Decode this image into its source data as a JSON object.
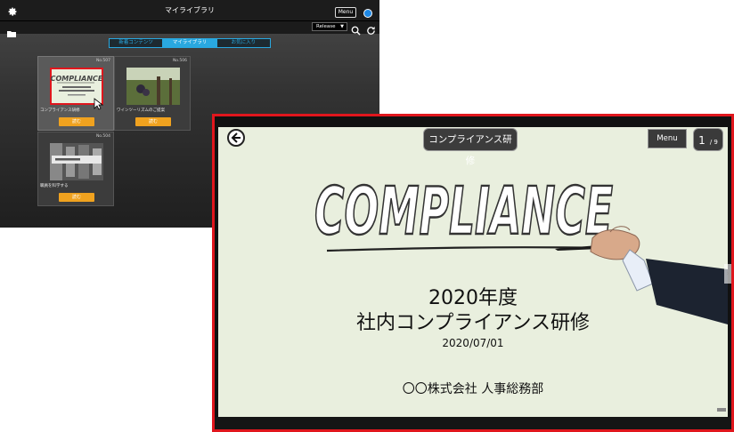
{
  "library": {
    "title": "マイライブラリ",
    "menu_label": "Menu",
    "release_select": "Release",
    "icons": {
      "settings": "gear-icon",
      "folder": "folder-icon",
      "search": "search-icon",
      "refresh": "refresh-icon",
      "user": "user-icon"
    },
    "tabs": [
      {
        "label": "新着コンテンツ",
        "active": false
      },
      {
        "label": "マイライブラリ",
        "active": true
      },
      {
        "label": "お気に入り",
        "active": false
      }
    ],
    "cards": [
      {
        "no": "No.507",
        "label": "コンプライアンス研修",
        "button": "読む"
      },
      {
        "no": "No.506",
        "label": "ワインツーリズムのご提案",
        "button": "読む"
      },
      {
        "no": "No.504",
        "label": "職員を科学する",
        "button": "読む"
      }
    ],
    "colors": {
      "accent": "#29a8e0",
      "button": "#f0a21f"
    }
  },
  "viewer": {
    "deck_title": "コンプライアンス研修",
    "menu_label": "Menu",
    "page": {
      "current": "1",
      "total": "/ 9"
    },
    "border_color": "#e0161d",
    "slide": {
      "headline": "COMPLIANCE",
      "year": "2020年度",
      "course": "社内コンプライアンス研修",
      "date": "2020/07/01",
      "department": "〇〇株式会社 人事総務部"
    }
  }
}
